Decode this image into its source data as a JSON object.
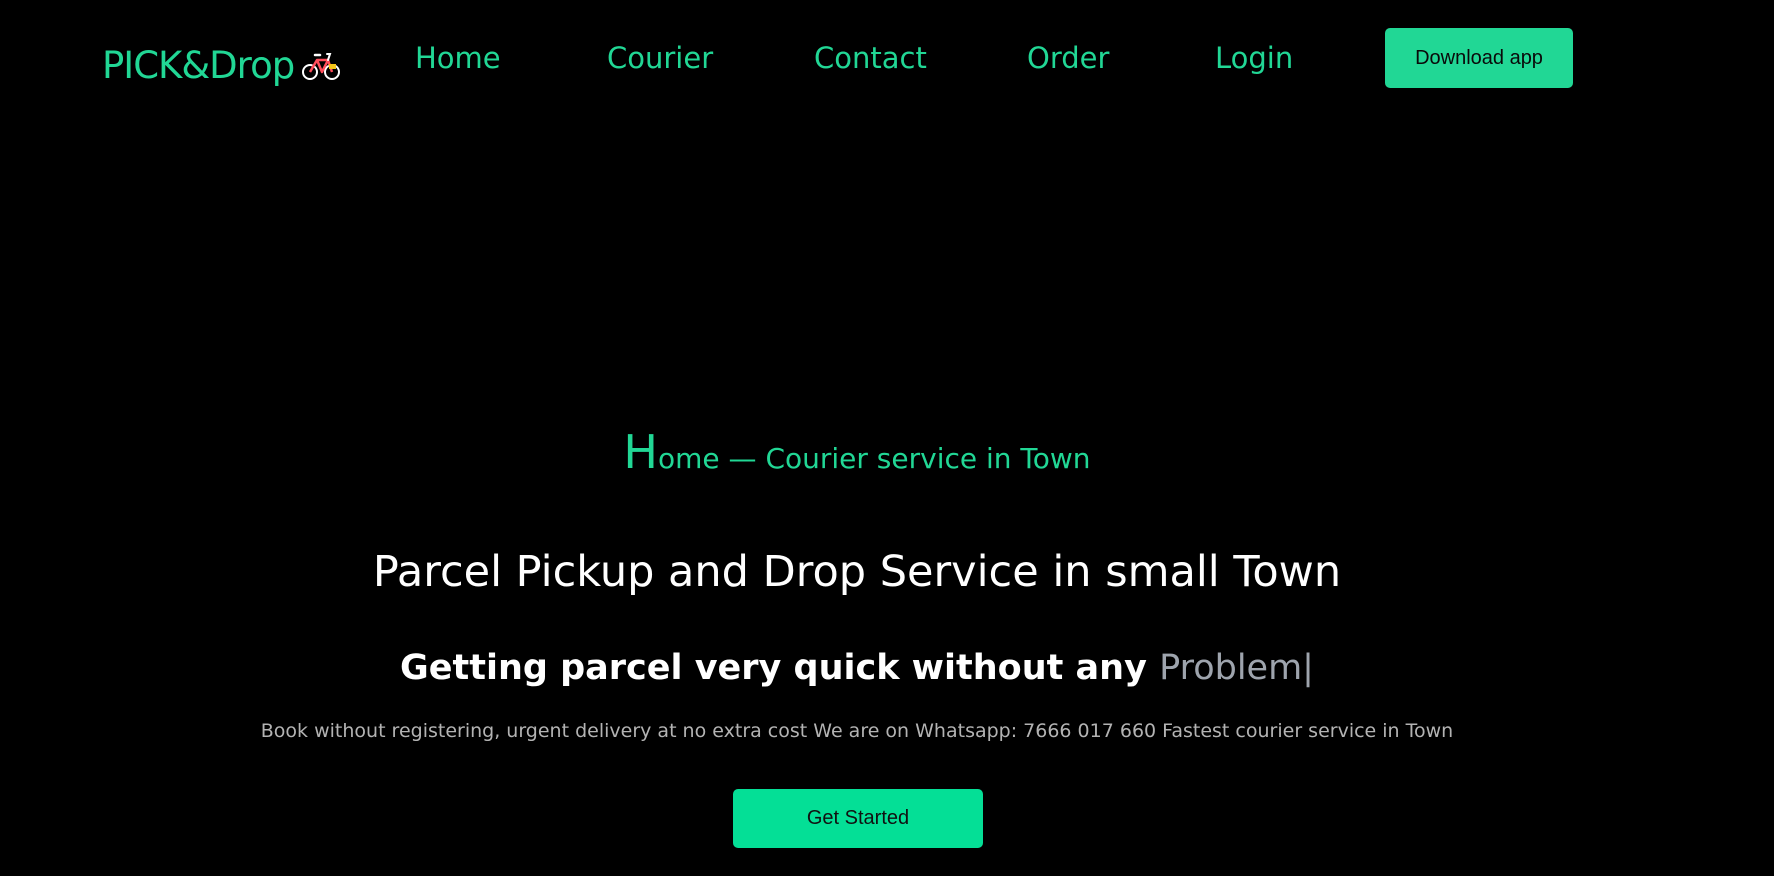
{
  "brand": {
    "name": "PICK&Drop",
    "logo_icon": "bicycle-icon"
  },
  "nav": {
    "items": [
      {
        "label": "Home"
      },
      {
        "label": "Courier"
      },
      {
        "label": "Contact"
      },
      {
        "label": "Order"
      },
      {
        "label": "Login"
      }
    ],
    "download_label": "Download app"
  },
  "hero": {
    "eyebrow_initial": "H",
    "eyebrow_rest": "ome — Courier service in Town",
    "headline": "Parcel Pickup and Drop Service in small Town",
    "subheadline_prefix": "Getting parcel very quick without any ",
    "subheadline_typed": "Problem|",
    "description": "Book without registering, urgent delivery at no extra cost We are on Whatsapp: 7666 017 660 Fastest courier service in Town",
    "cta_label": "Get Started"
  },
  "colors": {
    "background": "#000000",
    "accent": "#21d795",
    "cta": "#04df96",
    "heading": "#ffffff",
    "muted": "#b3b3b3",
    "typed_word": "#9ea4ad"
  }
}
